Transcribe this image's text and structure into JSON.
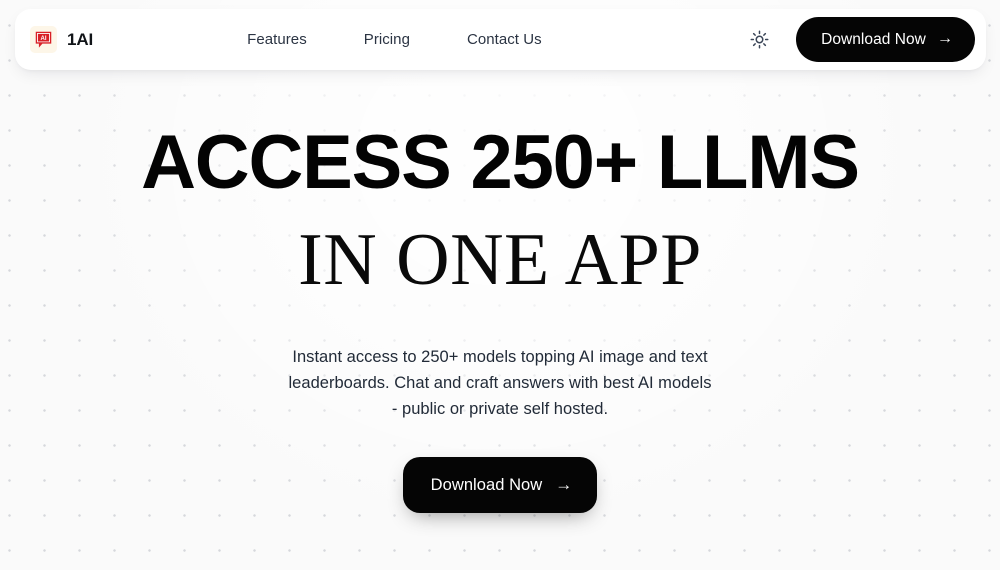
{
  "header": {
    "brand": {
      "mark_icon": "ai-chat-bubble-icon",
      "mark_text": "AI",
      "name": "1AI"
    },
    "nav": [
      {
        "label": "Features"
      },
      {
        "label": "Pricing"
      },
      {
        "label": "Contact Us"
      }
    ],
    "theme_toggle": {
      "icon": "sun-icon",
      "mode": "light"
    },
    "cta": {
      "label": "Download Now",
      "arrow": "→"
    }
  },
  "hero": {
    "headline_line_1": "ACCESS 250+ LLMS",
    "headline_line_2": "IN ONE APP",
    "subtitle": "Instant access to 250+ models topping AI image and text leaderboards. Chat and craft answers with best AI models - public or private self hosted.",
    "cta": {
      "label": "Download Now",
      "arrow": "→"
    }
  },
  "colors": {
    "page_background": "#fafafa",
    "header_surface": "#ffffff",
    "dot_grid": "#d6d8dc",
    "brand_red": "#d81f26",
    "brand_mark_background": "#fdf6e8",
    "button_background": "#050505",
    "button_text": "#ffffff",
    "nav_text": "#2b3443",
    "heading_text": "#030303",
    "subtitle_text": "#222b38"
  }
}
